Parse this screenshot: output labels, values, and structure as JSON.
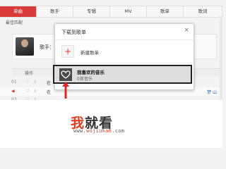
{
  "tabs": [
    "单曲",
    "歌手",
    "专辑",
    "MV",
    "歌单",
    "歌词"
  ],
  "best_match": "最佳匹配",
  "artist": {
    "label": "歌手："
  },
  "table": {
    "op_header": "操作"
  },
  "rows": [
    {
      "idx": "01",
      "ops": "♡ ⇩",
      "title": "在",
      "album": ""
    },
    {
      "idx": "◀",
      "ops": "♡ ⇩",
      "title": "在",
      "album": "梦 山"
    },
    {
      "idx": "03",
      "ops": "♡ ⇩",
      "title": "",
      "album": ""
    }
  ],
  "dialog": {
    "title": "下载到歌单",
    "close": "×",
    "new_playlist": "新建歌单",
    "favorite_title": "我喜欢的音乐",
    "favorite_count": "0首音乐"
  },
  "watermark": {
    "big_red": "我",
    "big_dark": "就看",
    "url_prefix": "www.",
    "url_red": "wojiukan",
    "url_suffix": ".com"
  },
  "colors": {
    "accent": "#d93b3b",
    "watermark_red": "#e33b1f"
  },
  "icons": [
    "close-icon",
    "plus-icon",
    "heart-icon",
    "arrow-up-icon"
  ]
}
